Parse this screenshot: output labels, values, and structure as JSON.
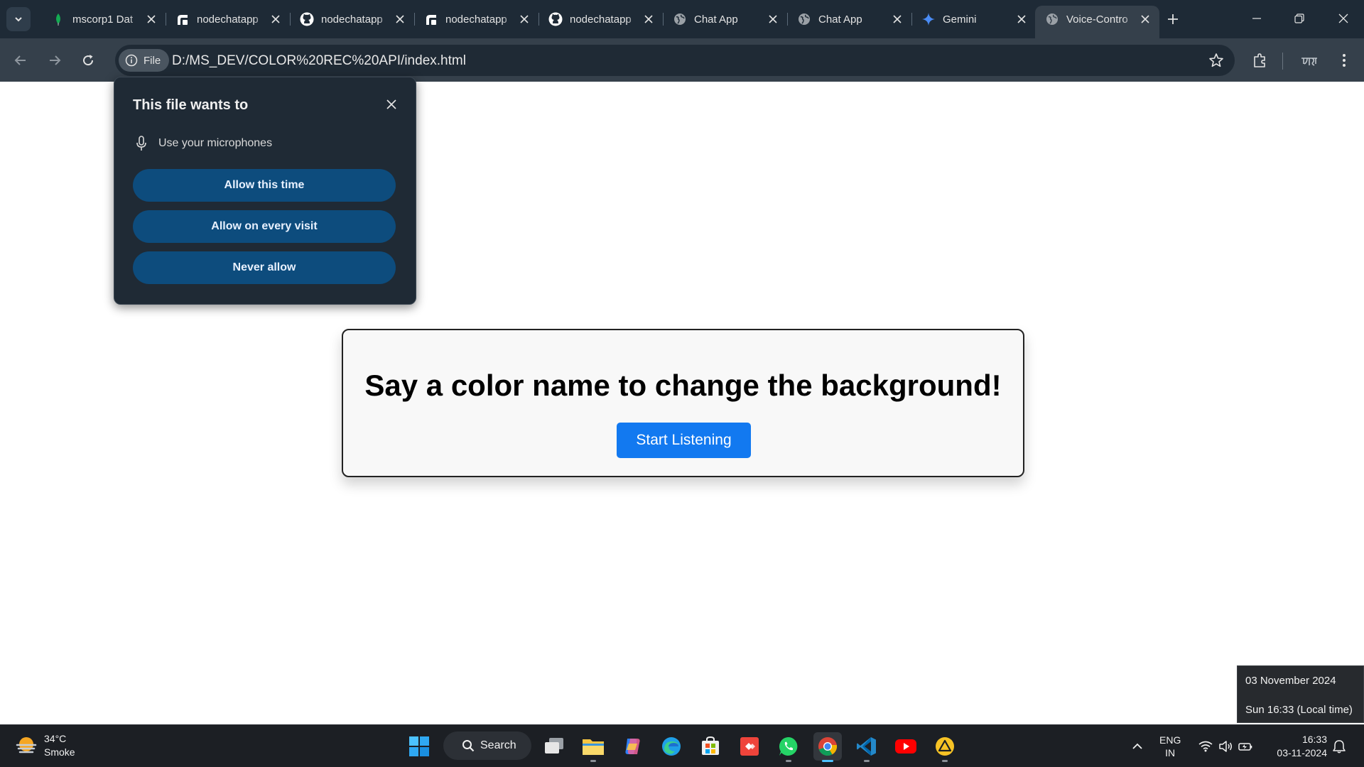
{
  "browser": {
    "tabs": [
      {
        "title": "mscorp1 Dat",
        "icon": "mongodb-leaf-icon"
      },
      {
        "title": "nodechatapp",
        "icon": "render-icon"
      },
      {
        "title": "nodechatapp",
        "icon": "github-icon"
      },
      {
        "title": "nodechatapp",
        "icon": "render-icon"
      },
      {
        "title": "nodechatapp",
        "icon": "github-icon"
      },
      {
        "title": "Chat App",
        "icon": "globe-icon"
      },
      {
        "title": "Chat App",
        "icon": "globe-icon"
      },
      {
        "title": "Gemini",
        "icon": "gemini-sparkle-icon"
      },
      {
        "title": "Voice-Contro",
        "icon": "globe-icon",
        "active": true
      }
    ],
    "address_chip": "File",
    "url": "D:/MS_DEV/COLOR%20REC%20API/index.html"
  },
  "permission_prompt": {
    "title": "This file wants to",
    "request": "Use your microphones",
    "allow_once": "Allow this time",
    "allow_always": "Allow on every visit",
    "never": "Never allow"
  },
  "page": {
    "heading": "Say a color name to change the background!",
    "button": "Start Listening",
    "button_color": "#1279f0"
  },
  "datetime_tooltip": {
    "date": "03 November 2024",
    "local": "Sun 16:33 (Local time)"
  },
  "taskbar": {
    "weather": {
      "temp": "34°C",
      "condition": "Smoke"
    },
    "search_label": "Search",
    "apps": [
      "windows-start-icon",
      "search-icon",
      "task-view-icon",
      "file-explorer-icon",
      "copilot-icon",
      "edge-icon",
      "store-icon",
      "anydesk-icon",
      "whatsapp-icon",
      "chrome-icon",
      "vscode-icon",
      "youtube-icon",
      "warning-app-icon"
    ],
    "language": {
      "line1": "ENG",
      "line2": "IN"
    },
    "clock": {
      "time": "16:33",
      "date": "03-11-2024"
    }
  }
}
